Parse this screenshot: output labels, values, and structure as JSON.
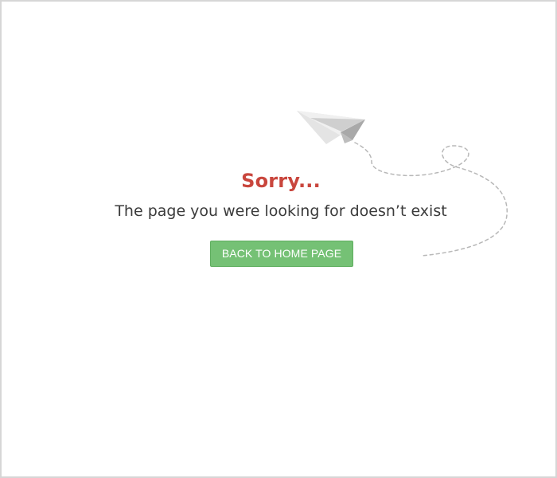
{
  "error": {
    "title": "Sorry...",
    "message": "The page you were looking for doesn’t exist"
  },
  "actions": {
    "home_button_label": "BACK TO HOME PAGE"
  },
  "icons": {
    "illustration": "paper-plane-icon"
  },
  "colors": {
    "title": "#c9463d",
    "message": "#3b3b3b",
    "button_background": "#75c175",
    "button_text": "#ffffff",
    "frame_border": "#d6d6d6",
    "dashed_trail": "#b8b8b8"
  }
}
